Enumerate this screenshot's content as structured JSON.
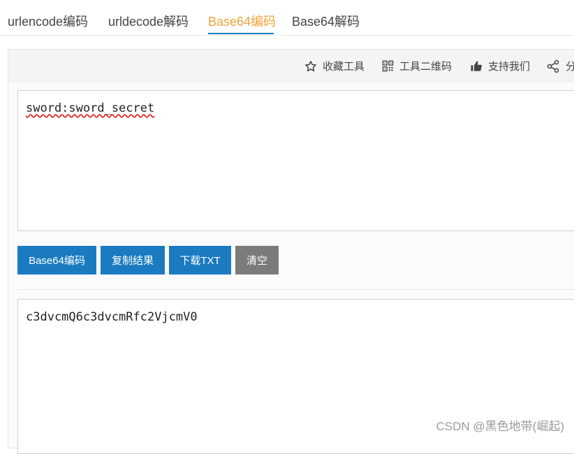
{
  "tabs": [
    {
      "label": "urlencode编码",
      "active": false
    },
    {
      "label": "urldecode解码",
      "active": false
    },
    {
      "label": "Base64编码",
      "active": true
    },
    {
      "label": "Base64解码",
      "active": false
    }
  ],
  "toolbar": {
    "favorite": "收藏工具",
    "qrcode": "工具二维码",
    "support": "支持我们",
    "share": "分"
  },
  "input": {
    "value": "sword:sword_secret"
  },
  "buttons": {
    "encode": "Base64编码",
    "copy": "复制结果",
    "download": "下载TXT",
    "clear": "清空"
  },
  "output": {
    "value": "c3dvcmQ6c3dvcmRfc2VjcmV0"
  },
  "watermark": "CSDN @黑色地带(崛起)",
  "colors": {
    "accent_blue": "#1a7bc1",
    "active_tab": "#f0a23a",
    "clear_button": "#7b7b7b"
  }
}
